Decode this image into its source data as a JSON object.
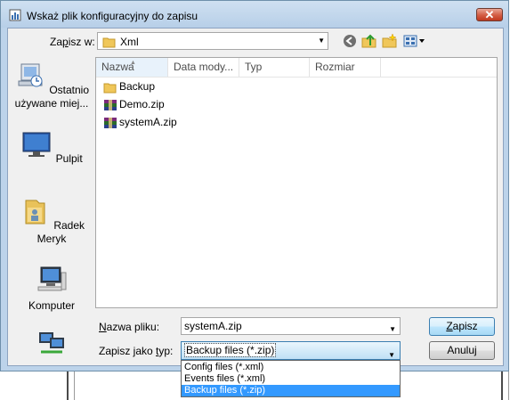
{
  "window": {
    "title": "Wskaż plik konfiguracyjny do zapisu",
    "close_symbol": "✕"
  },
  "toolbar": {
    "save_in_label_pre": "Za",
    "save_in_label_u": "p",
    "save_in_label_post": "isz w:",
    "save_in_value": "Xml",
    "icons": [
      "back-icon",
      "up-folder-icon",
      "new-folder-icon",
      "view-menu-icon"
    ]
  },
  "places": [
    {
      "label": "Ostatnio używane miej...",
      "icon": "recent-places-icon"
    },
    {
      "label": "Pulpit",
      "icon": "desktop-icon"
    },
    {
      "label": "Radek Meryk",
      "icon": "user-folder-icon"
    },
    {
      "label": "Komputer",
      "icon": "computer-icon"
    },
    {
      "label": "",
      "icon": "network-icon"
    }
  ],
  "file_list": {
    "columns": [
      "Nazwa",
      "Data mody...",
      "Typ",
      "Rozmiar"
    ],
    "sorted_column": "Nazwa",
    "files": [
      {
        "name": "Backup",
        "icon": "folder-icon"
      },
      {
        "name": "Demo.zip",
        "icon": "zip-archive-icon"
      },
      {
        "name": "systemA.zip",
        "icon": "zip-archive-icon"
      }
    ]
  },
  "form": {
    "file_name_label_u": "N",
    "file_name_label_rest": "azwa pliku:",
    "file_name_value": "systemA.zip",
    "file_type_label_pre": "Zapisz jako ",
    "file_type_label_u": "t",
    "file_type_label_post": "yp:",
    "file_type_value": "Backup files (*.zip)",
    "file_type_options": [
      "Config files (*.xml)",
      "Events files (*.xml)",
      "Backup files (*.zip)"
    ],
    "selected_option_index": 2
  },
  "buttons": {
    "save_u": "Z",
    "save_rest": "apisz",
    "cancel": "Anuluj"
  },
  "colors": {
    "title_bar": "#bcd3ea",
    "close_button": "#d35c43",
    "selection": "#3399ff",
    "zip_icon": "#7a2a7a"
  }
}
